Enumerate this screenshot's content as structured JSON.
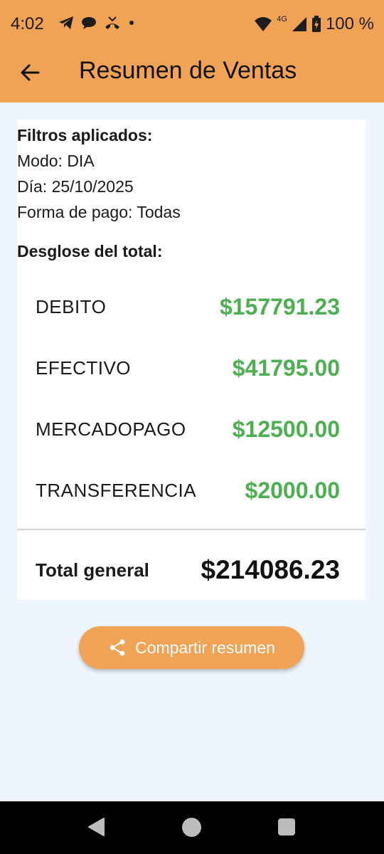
{
  "status_bar": {
    "time": "4:02",
    "battery": "100 %",
    "network": "4G",
    "left_icons": [
      "telegram-icon",
      "chat-bubble-icon",
      "missed-call-icon",
      "dot-icon"
    ],
    "right_icons": [
      "wifi-icon",
      "signal-icon",
      "battery-charging-icon"
    ]
  },
  "app_bar": {
    "title": "Resumen de Ventas",
    "back_icon": "arrow-back-icon"
  },
  "filters": {
    "heading": "Filtros aplicados:",
    "mode": "Modo: DIA",
    "day": "Día: 25/10/2025",
    "payment": "Forma de pago: Todas"
  },
  "breakdown": {
    "heading": "Desglose del total:",
    "items": [
      {
        "label": "DEBITO",
        "amount": "$157791.23"
      },
      {
        "label": "EFECTIVO",
        "amount": "$41795.00"
      },
      {
        "label": "MERCADOPAGO",
        "amount": "$12500.00"
      },
      {
        "label": "TRANSFERENCIA",
        "amount": "$2000.00"
      }
    ]
  },
  "total": {
    "label": "Total general",
    "amount": "$214086.23"
  },
  "share_button": {
    "label": "Compartir resumen",
    "icon": "share-icon"
  },
  "colors": {
    "accent": "#f0a354",
    "amount_green": "#4caf50",
    "background": "#eef5fd"
  }
}
